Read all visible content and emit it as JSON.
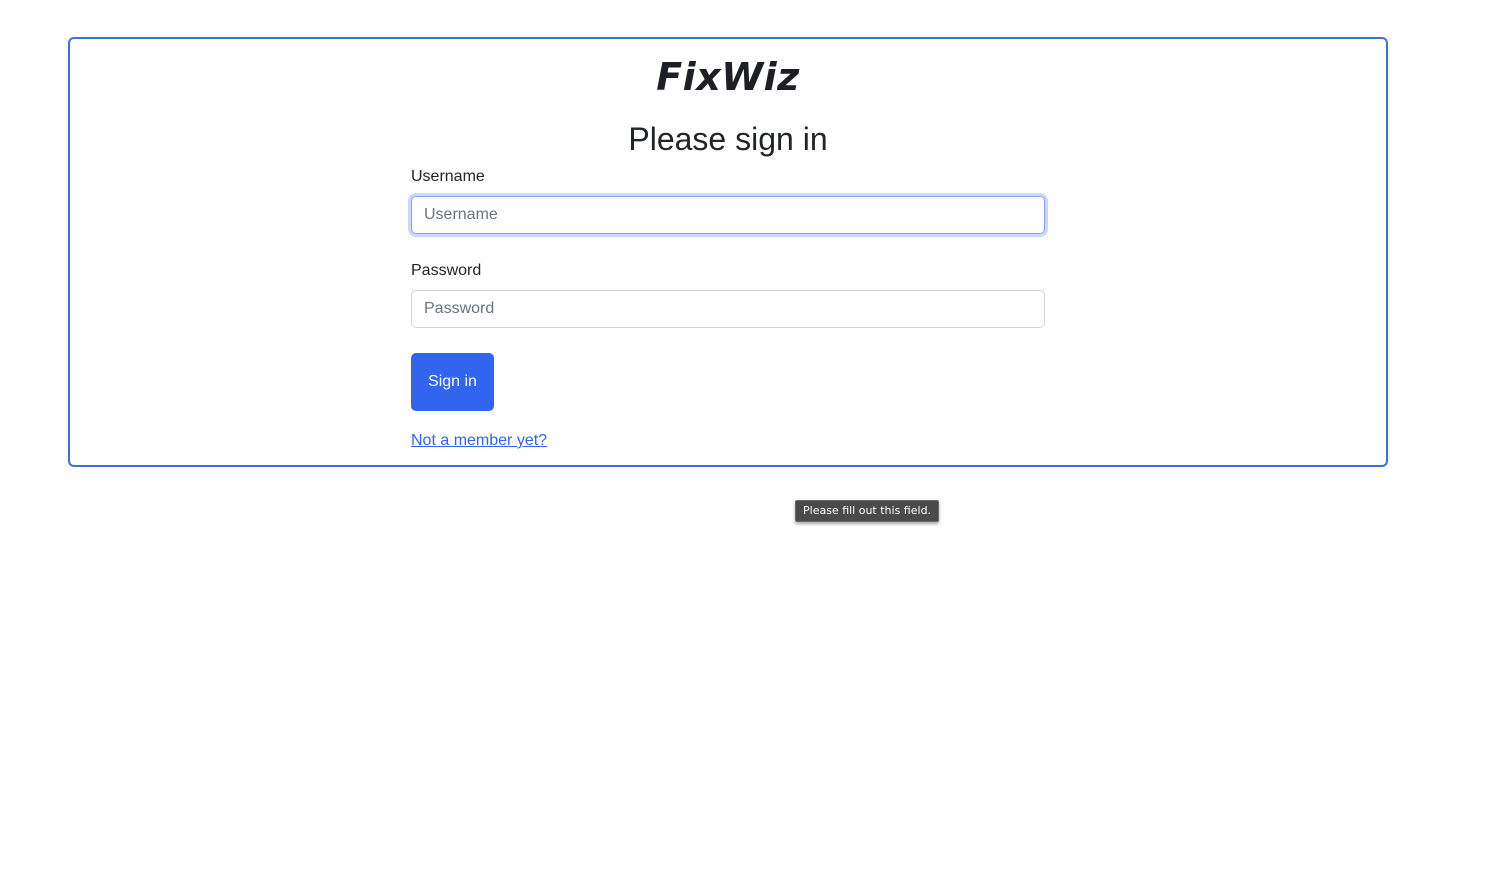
{
  "app": {
    "logo_text": "FixWiz"
  },
  "login": {
    "heading": "Please sign in",
    "username": {
      "label": "Username",
      "placeholder": "Username",
      "value": ""
    },
    "password": {
      "label": "Password",
      "placeholder": "Password",
      "value": ""
    },
    "submit_label": "Sign in",
    "signup_link_label": "Not a member yet?"
  },
  "validation_tooltip": {
    "text": "Please fill out this field."
  },
  "colors": {
    "accent": "#3165f0",
    "card_border": "#3a72d8",
    "tooltip_bg": "#4a4a4a"
  }
}
